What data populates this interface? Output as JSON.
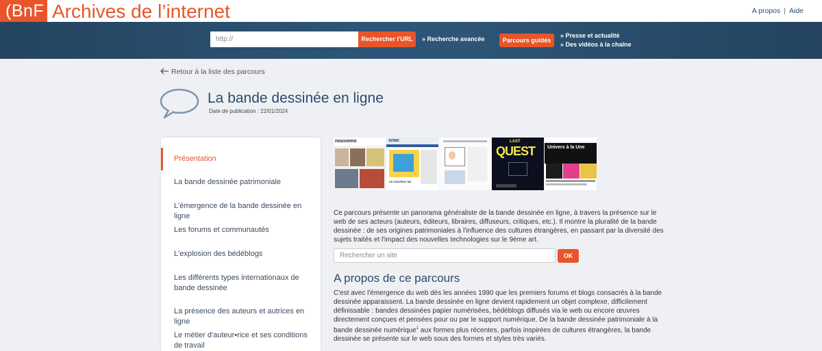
{
  "header": {
    "logo": "(BnF",
    "title": "Archives de l’internet",
    "links": {
      "about": "A propos",
      "separator": "|",
      "help": "Aide"
    }
  },
  "search": {
    "url_placeholder": "http://",
    "url_button": "Rechercher l'URL",
    "advanced_link": "» Recherche avancée",
    "parcours_button": "Parcours guidés",
    "press_link": "» Presse et actualité",
    "videos_link": "» Des vidéos à la chaîne"
  },
  "page": {
    "back_link": "Retour à la liste des parcours",
    "title": "La bande dessinée en ligne",
    "publication_date": "Date de publication : 22/01/2024"
  },
  "sidebar": {
    "items": [
      {
        "label": "Présentation",
        "active": true
      },
      {
        "label": "La bande dessinée patrimoniale"
      },
      {
        "label": "L'émergence de la bande dessinée en ligne"
      },
      {
        "label": "Les forums et communautés"
      },
      {
        "label": "L'explosion des bédéblogs"
      },
      {
        "label": "Les différents types internationaux de bande dessinée"
      },
      {
        "label": "La présence des auteurs et autrices en ligne"
      },
      {
        "label": "Le métier d'auteur•rice et ses conditions de travail"
      }
    ]
  },
  "thumbnails": {
    "t1": "nouvomo",
    "t2": "snac",
    "t3": "LE CONTRAT DE",
    "t4_top": "LAST",
    "t4_main": "QUEST",
    "t5_title": "Univers à la Une"
  },
  "intro": "Ce parcours présente un panorama généraliste de la bande dessinée en ligne, à travers la présence sur le web de ses acteurs (auteurs, éditeurs, libraires, diffuseurs, critiques, etc.). Il montre la pluralité de la bande dessinée : de ses origines patrimoniales à l'influence des cultures étrangères, en passant par la diversité des sujets traités et l'impact des nouvelles technologies sur le 9ème art.",
  "site_search": {
    "placeholder": "Rechercher un site",
    "button": "OK"
  },
  "about": {
    "title": "A propos de ce parcours",
    "text_before_sup": "C'est avec l'émergence du web dès les années 1990 que les premiers forums et blogs consacrés à la bande dessinée apparaissent. La bande dessinée en ligne devient rapidement un objet complexe, difficilement définissable : bandes dessinées papier numérisées, bédéblogs diffusés via le web ou encore œuvres directement conçues et pensées pour ou par le support numérique. De la bande dessinée patrimoniale à la bande dessinée numérique",
    "sup": "1",
    "text_after_sup": " aux formes plus récentes, parfois inspirées de cultures étrangères, la bande dessinée se présente sur le web sous des formes et styles très variés."
  },
  "colors": {
    "accent": "#e8552a",
    "navy": "#2c4a6e",
    "band": "#2e5577"
  }
}
